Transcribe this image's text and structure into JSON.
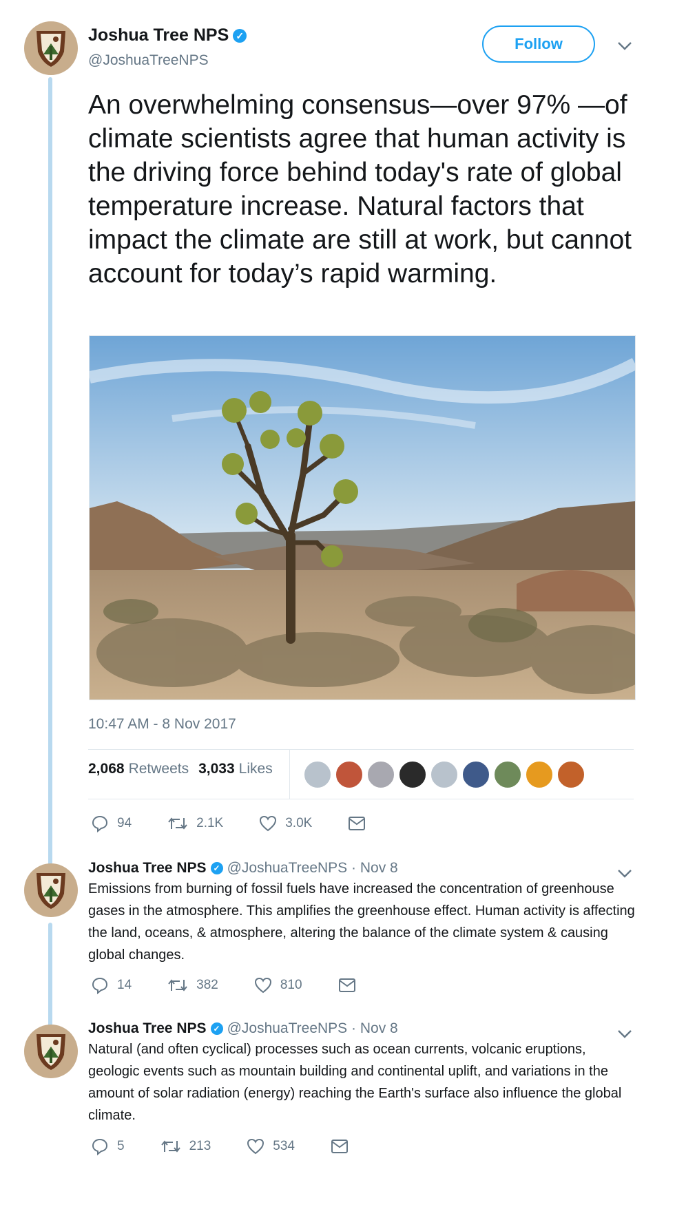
{
  "main": {
    "author_name": "Joshua Tree NPS",
    "handle": "@JoshuaTreeNPS",
    "follow_label": "Follow",
    "text": "An overwhelming consensus—over 97% —of climate scientists agree that human activity is the driving force behind today's rate of global temperature increase. Natural factors that impact the climate are still at work, but cannot account for today’s rapid warming.",
    "timestamp": "10:47 AM - 8 Nov 2017",
    "retweets_count": "2,068",
    "retweets_label": "Retweets",
    "likes_count": "3,033",
    "likes_label": "Likes",
    "replies": "94",
    "retweets_short": "2.1K",
    "likes_short": "3.0K"
  },
  "replies": [
    {
      "author_name": "Joshua Tree NPS",
      "meta": "@JoshuaTreeNPS · Nov 8",
      "text": "Emissions from burning of fossil fuels have increased the concentration of greenhouse gases in the atmosphere. This amplifies the greenhouse effect. Human activity is affecting the land, oceans, & atmosphere, altering the balance of the climate system & causing global changes.",
      "replies": "14",
      "retweets": "382",
      "likes": "810"
    },
    {
      "author_name": "Joshua Tree NPS",
      "meta": "@JoshuaTreeNPS · Nov 8",
      "text": "Natural (and often cyclical) processes such as ocean currents, volcanic eruptions, geologic events such as mountain building and continental uplift, and variations in the amount of solar radiation (energy) reaching the Earth's surface also influence the global climate.",
      "replies": "5",
      "retweets": "213",
      "likes": "534"
    }
  ],
  "colors": {
    "accent": "#1da1f2",
    "thread_line": "#b8d9ef",
    "muted_text": "#657786"
  },
  "icons": [
    "nps-arrowhead-logo",
    "verified-badge-icon",
    "chevron-down-icon",
    "reply-icon",
    "retweet-icon",
    "like-icon",
    "direct-message-icon"
  ]
}
